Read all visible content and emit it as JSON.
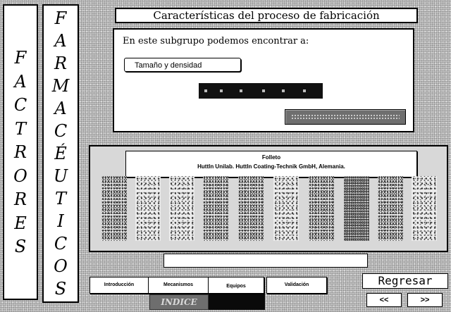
{
  "sidebar": {
    "factores": [
      "F",
      "A",
      "C",
      "T",
      "R",
      "O",
      "R",
      "E",
      "S"
    ],
    "farmaceuticos": [
      "F",
      "A",
      "R",
      "M",
      "A",
      "C",
      "É",
      "U",
      "T",
      "I",
      "C",
      "O",
      "S"
    ]
  },
  "header": {
    "title": "Características del proceso de fabricación"
  },
  "main": {
    "intro": "En este subgrupo podemos encontrar a:",
    "topic_button": "Tamaño y densidad"
  },
  "image_panel": {
    "title": "Folleto",
    "source": "Huttln Unilab. Huttln Coating-Technik GmbH, Alemania."
  },
  "tabs": [
    {
      "label": "Introducción"
    },
    {
      "label": "Mecanismos"
    },
    {
      "label": "Equipos"
    },
    {
      "label": "Validación"
    }
  ],
  "navigation": {
    "back_label": "Regresar",
    "prev_label": "<<",
    "next_label": ">>",
    "index_label": "INDICE"
  }
}
